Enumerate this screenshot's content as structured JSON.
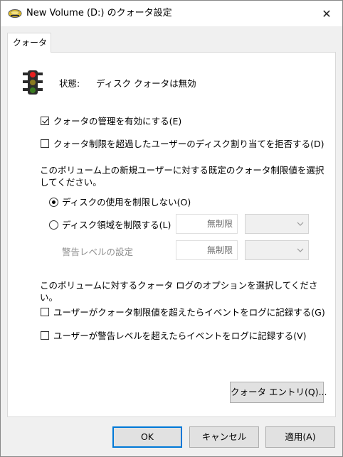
{
  "window": {
    "title": "New Volume (D:) のクォータ設定",
    "close_glyph": "✕"
  },
  "tabs": [
    {
      "label": "クォータ"
    }
  ],
  "status": {
    "label": "状態:",
    "value": "ディスク クォータは無効"
  },
  "options": {
    "enable_quota": {
      "label": "クォータの管理を有効にする(E)",
      "checked": true
    },
    "deny_space": {
      "label": "クォータ制限を超過したユーザーのディスク割り当てを拒否する(D)",
      "checked": false
    }
  },
  "defaults_section": {
    "description": "このボリューム上の新規ユーザーに対する既定のクォータ制限値を選択してください。",
    "no_limit": {
      "label": "ディスクの使用を制限しない(O)",
      "selected": true
    },
    "limit": {
      "label": "ディスク領域を制限する(L)",
      "selected": false,
      "value": "無制限"
    },
    "warning": {
      "label": "警告レベルの設定",
      "value": "無制限"
    }
  },
  "log_section": {
    "description": "このボリュームに対するクォータ ログのオプションを選択してください。",
    "log_limit": {
      "label": "ユーザーがクォータ制限値を超えたらイベントをログに記録する(G)",
      "checked": false
    },
    "log_warning": {
      "label": "ユーザーが警告レベルを超えたらイベントをログに記録する(V)",
      "checked": false
    }
  },
  "buttons": {
    "quota_entries": "クォータ エントリ(Q)...",
    "ok": "OK",
    "cancel": "キャンセル",
    "apply": "適用(A)"
  },
  "icons": {
    "title": "disk-drive-icon",
    "status": "traffic-light-icon"
  }
}
